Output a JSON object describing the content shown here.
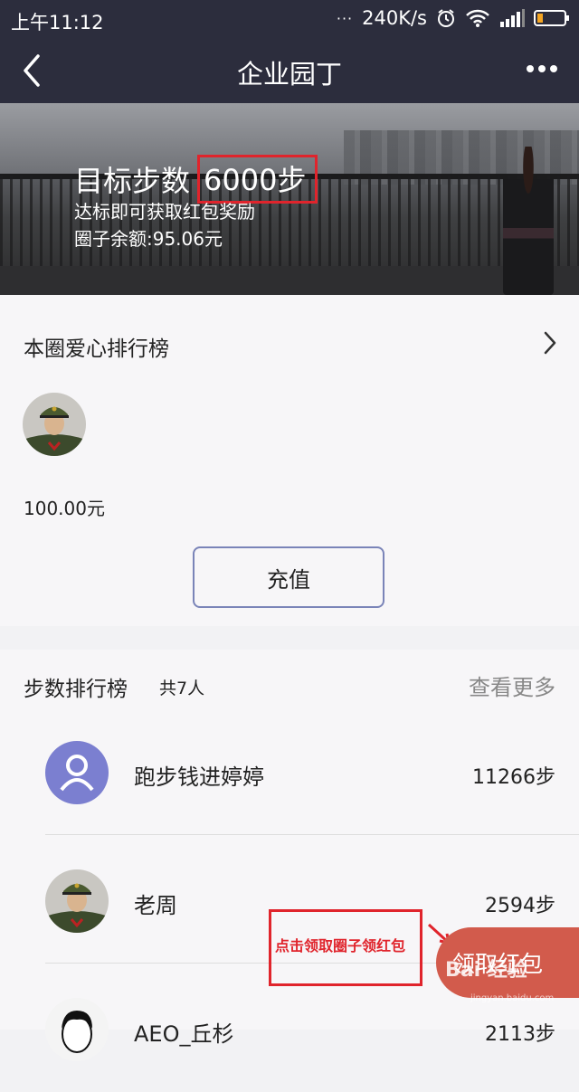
{
  "status_bar": {
    "time": "上午11:12",
    "dots": "···",
    "speed": "240K/s",
    "icons": [
      "alarm-icon",
      "wifi-icon",
      "signal-icon",
      "battery-icon"
    ]
  },
  "nav": {
    "title": "企业园丁",
    "back_icon": "back-icon",
    "more_icon": "more-icon"
  },
  "banner": {
    "target_label": "目标步数",
    "target_value": "6000步",
    "reward_text": "达标即可获取红包奖励",
    "balance_text": "圈子余额:95.06元"
  },
  "love_ranking": {
    "title": "本圈爱心排行榜",
    "amount": "100.00元",
    "charge_label": "充值"
  },
  "steps_ranking": {
    "title": "步数排行榜",
    "count": "共7人",
    "more_label": "查看更多",
    "rows": [
      {
        "name": "跑步钱进婷婷",
        "steps": "11266步",
        "avatar": "default-avatar"
      },
      {
        "name": "老周",
        "steps": "2594步",
        "avatar": "photo-avatar"
      },
      {
        "name": "AEO_丘杉",
        "steps": "2113步",
        "avatar": "photo-avatar"
      }
    ]
  },
  "annotation": {
    "text": "点击领取圈子领红包"
  },
  "claim_button": {
    "label": "领取红包"
  },
  "watermark": {
    "text": "Bai 经验",
    "sub": "jingyan.baidu.com"
  },
  "colors": {
    "header_bg": "#2c2d3d",
    "accent_red": "#e0242c",
    "claim_bg": "#d25b4c",
    "avatar_purple": "#7b7fd0"
  }
}
